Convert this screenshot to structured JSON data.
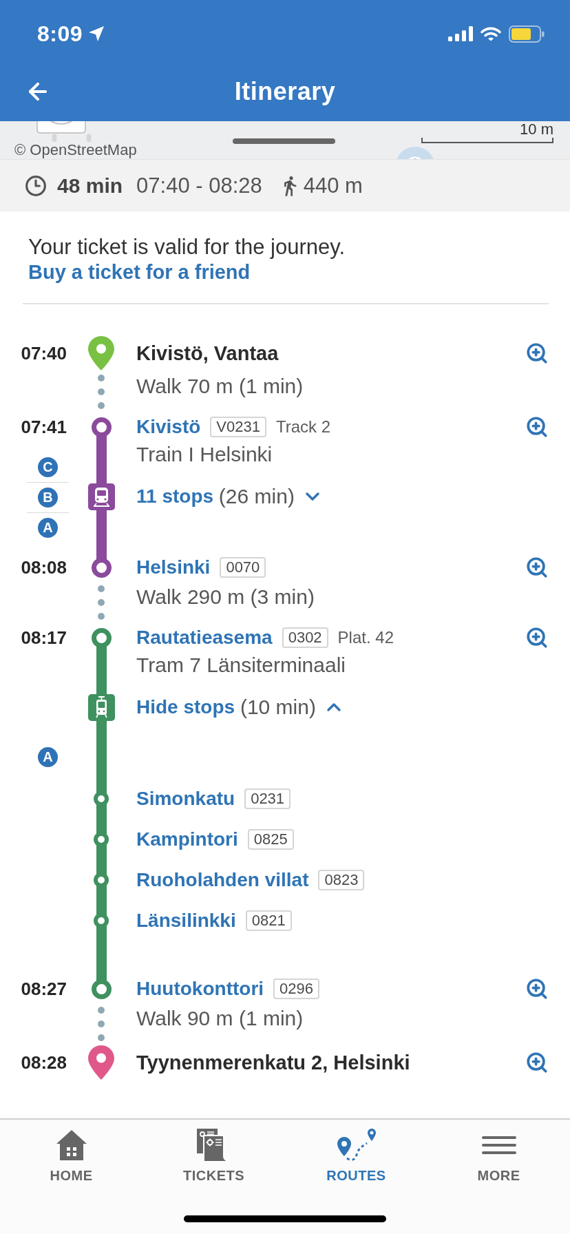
{
  "status_bar": {
    "time": "8:09"
  },
  "header": {
    "title": "Itinerary"
  },
  "map": {
    "attribution": "© OpenStreetMap",
    "scale": "10 m"
  },
  "summary": {
    "duration": "48 min",
    "time_range": "07:40 - 08:28",
    "walk_distance": "440 m"
  },
  "ticket": {
    "message": "Your ticket is valid for the journey.",
    "link": "Buy a ticket for a friend"
  },
  "legs": [
    {
      "kind": "place",
      "time": "07:40",
      "name": "Kivistö, Vantaa",
      "color": "#79c143"
    },
    {
      "kind": "walk",
      "text": "Walk 70 m (1 min)"
    },
    {
      "kind": "train",
      "color": "#8b4a9c",
      "start": {
        "time": "07:41",
        "name": "Kivistö",
        "code": "V0231",
        "platform": "Track 2"
      },
      "route": "Train I Helsinki",
      "toggle": {
        "label": "11 stops",
        "duration": "(26 min)",
        "expanded": false
      },
      "zones": [
        "C",
        "B",
        "A"
      ],
      "end": {
        "time": "08:08",
        "name": "Helsinki",
        "code": "0070"
      }
    },
    {
      "kind": "walk",
      "text": "Walk 290 m (3 min)"
    },
    {
      "kind": "tram",
      "color": "#3f9160",
      "start": {
        "time": "08:17",
        "name": "Rautatieasema",
        "code": "0302",
        "platform": "Plat. 42"
      },
      "route": "Tram 7 Länsiterminaali",
      "toggle": {
        "label": "Hide stops",
        "duration": "(10 min)",
        "expanded": true
      },
      "zones": [
        "A"
      ],
      "stops": [
        {
          "name": "Simonkatu",
          "code": "0231"
        },
        {
          "name": "Kampintori",
          "code": "0825"
        },
        {
          "name": "Ruoholahden villat",
          "code": "0823"
        },
        {
          "name": "Länsilinkki",
          "code": "0821"
        }
      ],
      "end": {
        "time": "08:27",
        "name": "Huutokonttori",
        "code": "0296"
      }
    },
    {
      "kind": "walk",
      "text": "Walk 90 m (1 min)"
    },
    {
      "kind": "place",
      "time": "08:28",
      "name": "Tyynenmerenkatu 2, Helsinki",
      "color": "#e0588a"
    }
  ],
  "tab_bar": {
    "tabs": [
      {
        "label": "HOME",
        "selected": false
      },
      {
        "label": "TICKETS",
        "selected": false
      },
      {
        "label": "ROUTES",
        "selected": true
      },
      {
        "label": "MORE",
        "selected": false
      }
    ]
  }
}
